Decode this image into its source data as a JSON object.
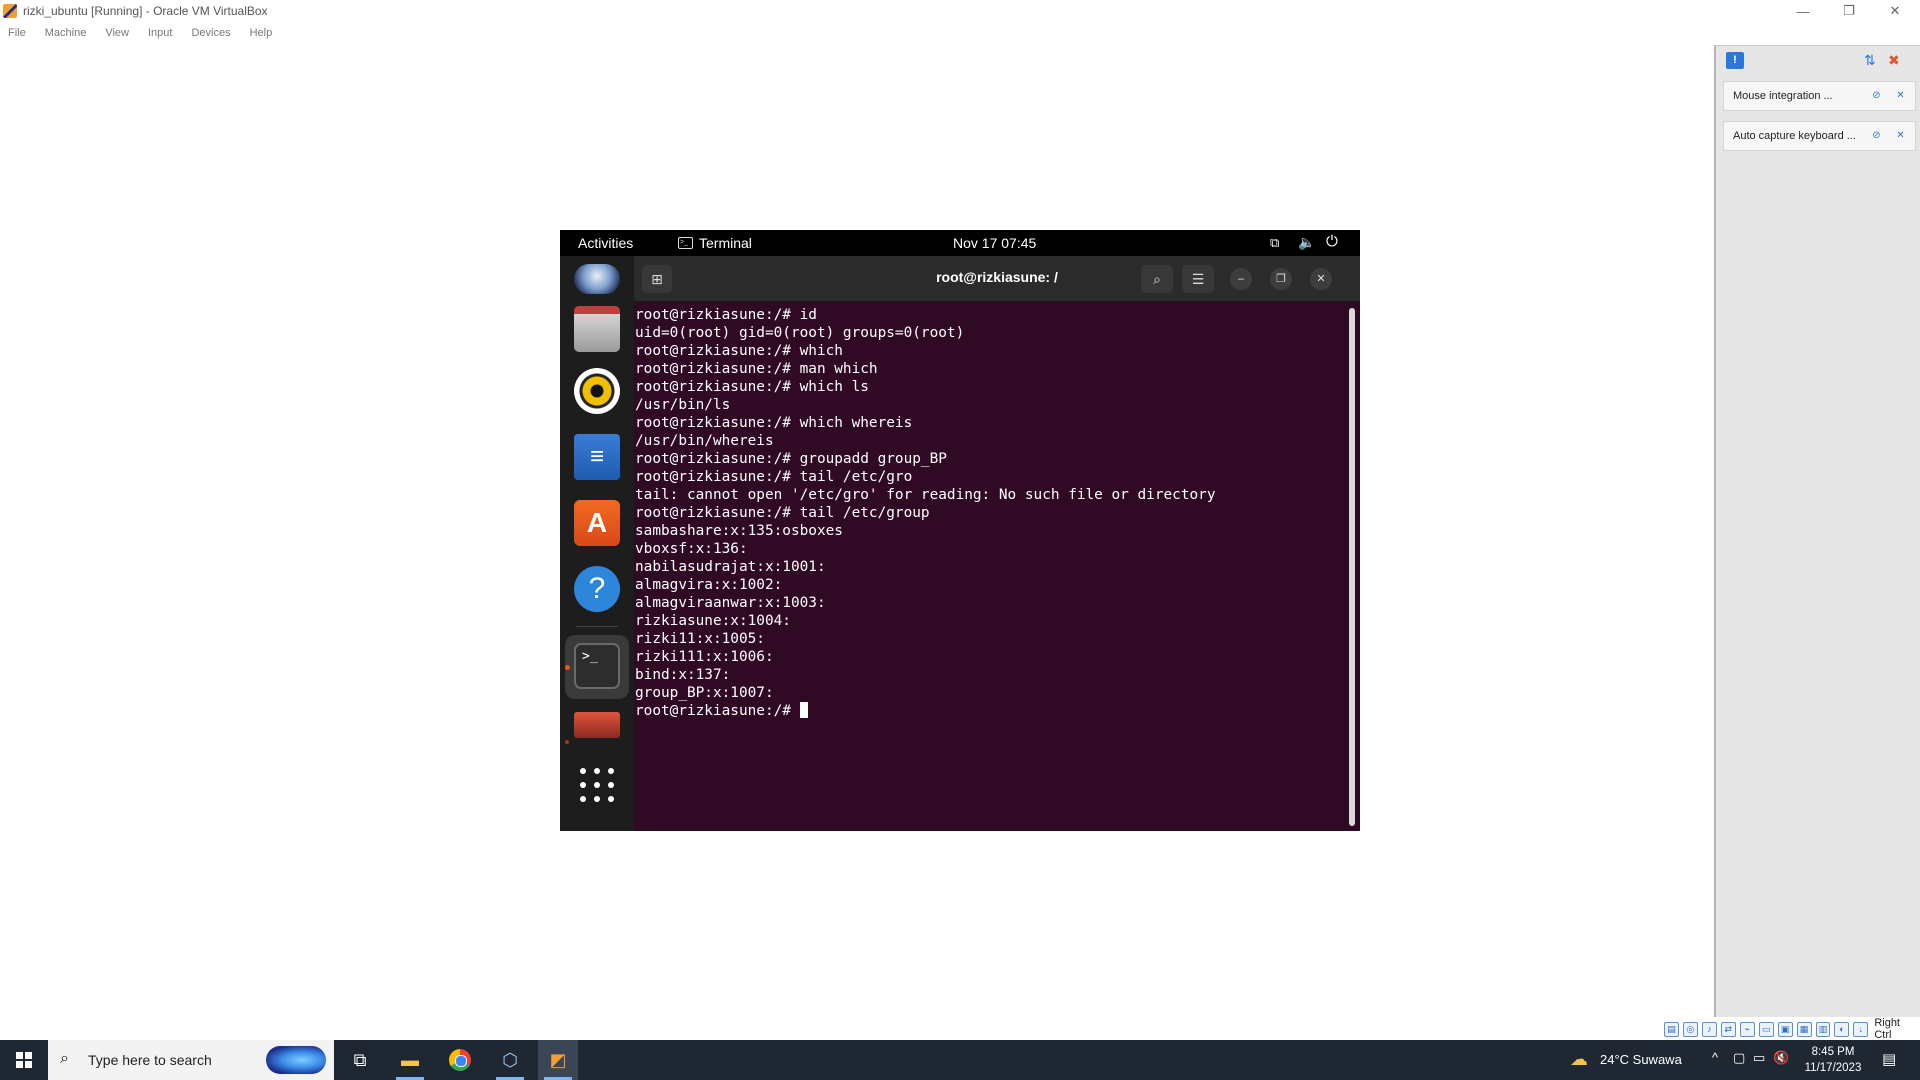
{
  "host_window": {
    "title": "rizki_ubuntu [Running] - Oracle VM VirtualBox",
    "controls": {
      "minimize": "—",
      "maximize": "❐",
      "close": "✕"
    }
  },
  "menubar": {
    "items": [
      "File",
      "Machine",
      "View",
      "Input",
      "Devices",
      "Help"
    ]
  },
  "notifications": {
    "items": [
      {
        "text": "Mouse integration ..."
      },
      {
        "text": "Auto capture keyboard ..."
      }
    ]
  },
  "gnome": {
    "activities": "Activities",
    "app_name": "Terminal",
    "clock": "Nov 17  07:45"
  },
  "terminal": {
    "title": "root@rizkiasune: /",
    "lines": [
      "root@rizkiasune:/# id",
      "uid=0(root) gid=0(root) groups=0(root)",
      "root@rizkiasune:/# which",
      "root@rizkiasune:/# man which",
      "root@rizkiasune:/# which ls",
      "/usr/bin/ls",
      "root@rizkiasune:/# which whereis",
      "/usr/bin/whereis",
      "root@rizkiasune:/# groupadd group_BP",
      "root@rizkiasune:/# tail /etc/gro",
      "tail: cannot open '/etc/gro' for reading: No such file or directory",
      "root@rizkiasune:/# tail /etc/group",
      "sambashare:x:135:osboxes",
      "vboxsf:x:136:",
      "nabilasudrajat:x:1001:",
      "almagvira:x:1002:",
      "almagviraanwar:x:1003:",
      "rizkiasune:x:1004:",
      "rizki11:x:1005:",
      "rizki111:x:1006:",
      "bind:x:137:",
      "group_BP:x:1007:"
    ],
    "prompt": "root@rizkiasune:/# "
  },
  "vbox_status": {
    "host_key": "Right Ctrl"
  },
  "taskbar": {
    "search_placeholder": "Type here to search",
    "weather": "24°C  Suwawa",
    "time": "8:45 PM",
    "date": "11/17/2023"
  }
}
